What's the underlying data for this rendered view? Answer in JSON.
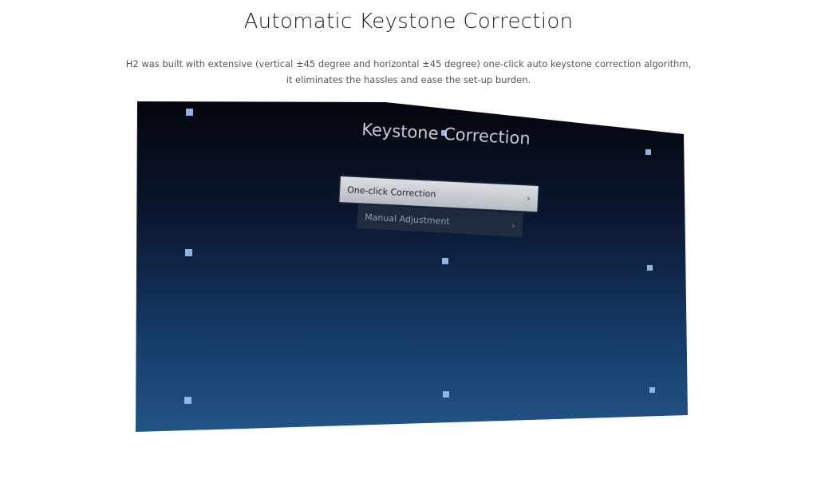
{
  "heading": {
    "title": "Automatic Keystone Correction",
    "description_line1": "H2 was built with extensive (vertical ±45 degree and horizontal ±45 degree) one-click auto keystone correction algorithm,",
    "description_line2": "it eliminates the hassles and ease the set-up burden."
  },
  "projection": {
    "screen_title": "Keystone Correction",
    "menu": [
      {
        "label": "One-click Correction",
        "selected": true,
        "chevron_icon": "chevron-right-icon"
      },
      {
        "label": "Manual Adjustment",
        "selected": false,
        "chevron_icon": "chevron-right-icon"
      }
    ],
    "marker_count": 9,
    "colors": {
      "screen_top": "#05070f",
      "screen_bottom": "#1e4d7f",
      "marker": "#8fb4e4",
      "selected_item": "#d1d3d9"
    }
  }
}
